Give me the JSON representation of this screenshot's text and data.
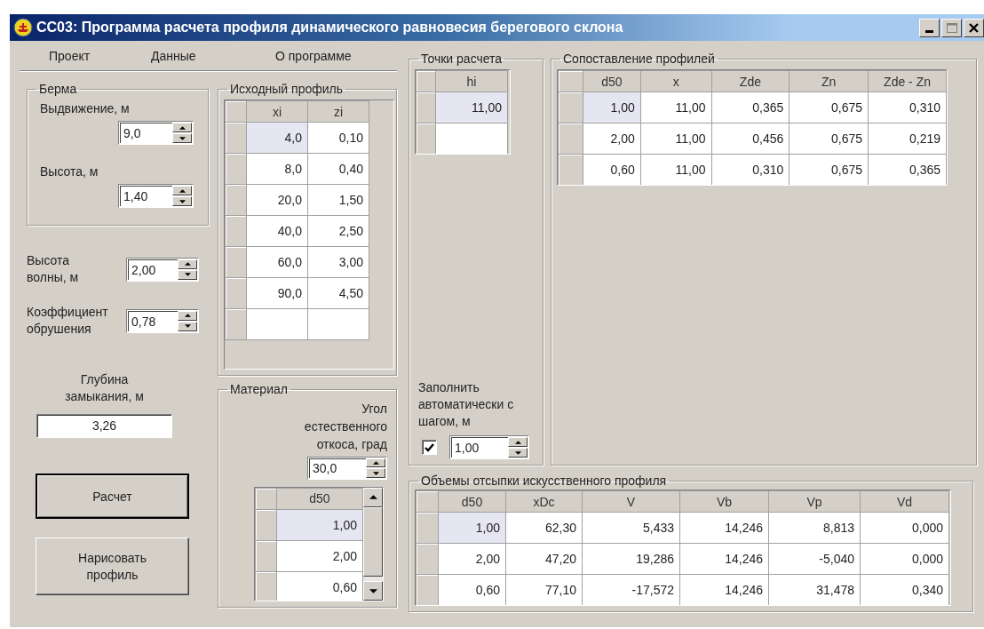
{
  "window": {
    "title": "СС03: Программа расчета профиля динамического равновесия берегового склона"
  },
  "menu": [
    "Проект",
    "Данные",
    "О программе"
  ],
  "berma": {
    "title": "Берма",
    "fields": [
      {
        "label": "Выдвижение, м",
        "value": "9,0"
      },
      {
        "label": "Высота, м",
        "value": "1,40"
      }
    ]
  },
  "wave_height": {
    "label": "Высота волны, м",
    "value": "2,00"
  },
  "breaking_coef": {
    "label": "Коэффициент обрушения",
    "value": "0,78"
  },
  "closure_depth": {
    "label": "Глубина замыкания, м",
    "value": "3,26"
  },
  "buttons": [
    "Расчет",
    "Нарисовать профиль"
  ],
  "source_profile": {
    "title": "Исходный профиль",
    "grid": {
      "columns": [
        "xi",
        "zi"
      ],
      "new_row": true,
      "rows": [
        {
          "cells": [
            "4,0",
            "0,10"
          ],
          "selected": true
        },
        {
          "cells": [
            "8,0",
            "0,40"
          ],
          "selected": false
        },
        {
          "cells": [
            "20,0",
            "1,50"
          ],
          "selected": false
        },
        {
          "cells": [
            "40,0",
            "2,50"
          ],
          "selected": false
        },
        {
          "cells": [
            "60,0",
            "3,00"
          ],
          "selected": false
        },
        {
          "cells": [
            "90,0",
            "4,50"
          ],
          "selected": false
        }
      ]
    }
  },
  "material": {
    "title": "Материал",
    "angle_label": "Угол естественного откоса, град",
    "angle_value": "30,0",
    "grid": {
      "columns": [
        "d50"
      ],
      "new_row": false,
      "rows": [
        {
          "cells": [
            "1,00"
          ],
          "selected": true
        },
        {
          "cells": [
            "2,00"
          ],
          "selected": false
        },
        {
          "cells": [
            "0,60"
          ],
          "selected": false
        }
      ]
    }
  },
  "calc_points": {
    "title": "Точки расчета",
    "grid": {
      "columns": [
        "hi"
      ],
      "new_row": true,
      "rows": [
        {
          "cells": [
            "11,00"
          ],
          "selected": true
        }
      ]
    },
    "autofill": {
      "label": "Заполнить автоматически с шагом, м",
      "checked": true,
      "value": "1,00"
    }
  },
  "comparison": {
    "title": "Сопоставление профилей",
    "grid": {
      "columns": [
        "d50",
        "x",
        "Zde",
        "Zn",
        "Zde - Zn"
      ],
      "new_row": false,
      "rows": [
        {
          "cells": [
            "1,00",
            "11,00",
            "0,365",
            "0,675",
            "0,310"
          ],
          "selected": true
        },
        {
          "cells": [
            "2,00",
            "11,00",
            "0,456",
            "0,675",
            "0,219"
          ],
          "selected": false
        },
        {
          "cells": [
            "0,60",
            "11,00",
            "0,310",
            "0,675",
            "0,365"
          ],
          "selected": false
        }
      ]
    }
  },
  "volumes": {
    "title": "Объемы отсыпки искусственного профиля",
    "grid": {
      "columns": [
        "d50",
        "xDc",
        "V",
        "Vb",
        "Vp",
        "Vd"
      ],
      "new_row": false,
      "rows": [
        {
          "cells": [
            "1,00",
            "62,30",
            "5,433",
            "14,246",
            "8,813",
            "0,000"
          ],
          "selected": true
        },
        {
          "cells": [
            "2,00",
            "47,20",
            "19,286",
            "14,246",
            "-5,040",
            "0,000"
          ],
          "selected": false
        },
        {
          "cells": [
            "0,60",
            "77,10",
            "-17,572",
            "14,246",
            "31,478",
            "0,340"
          ],
          "selected": false
        }
      ]
    }
  }
}
